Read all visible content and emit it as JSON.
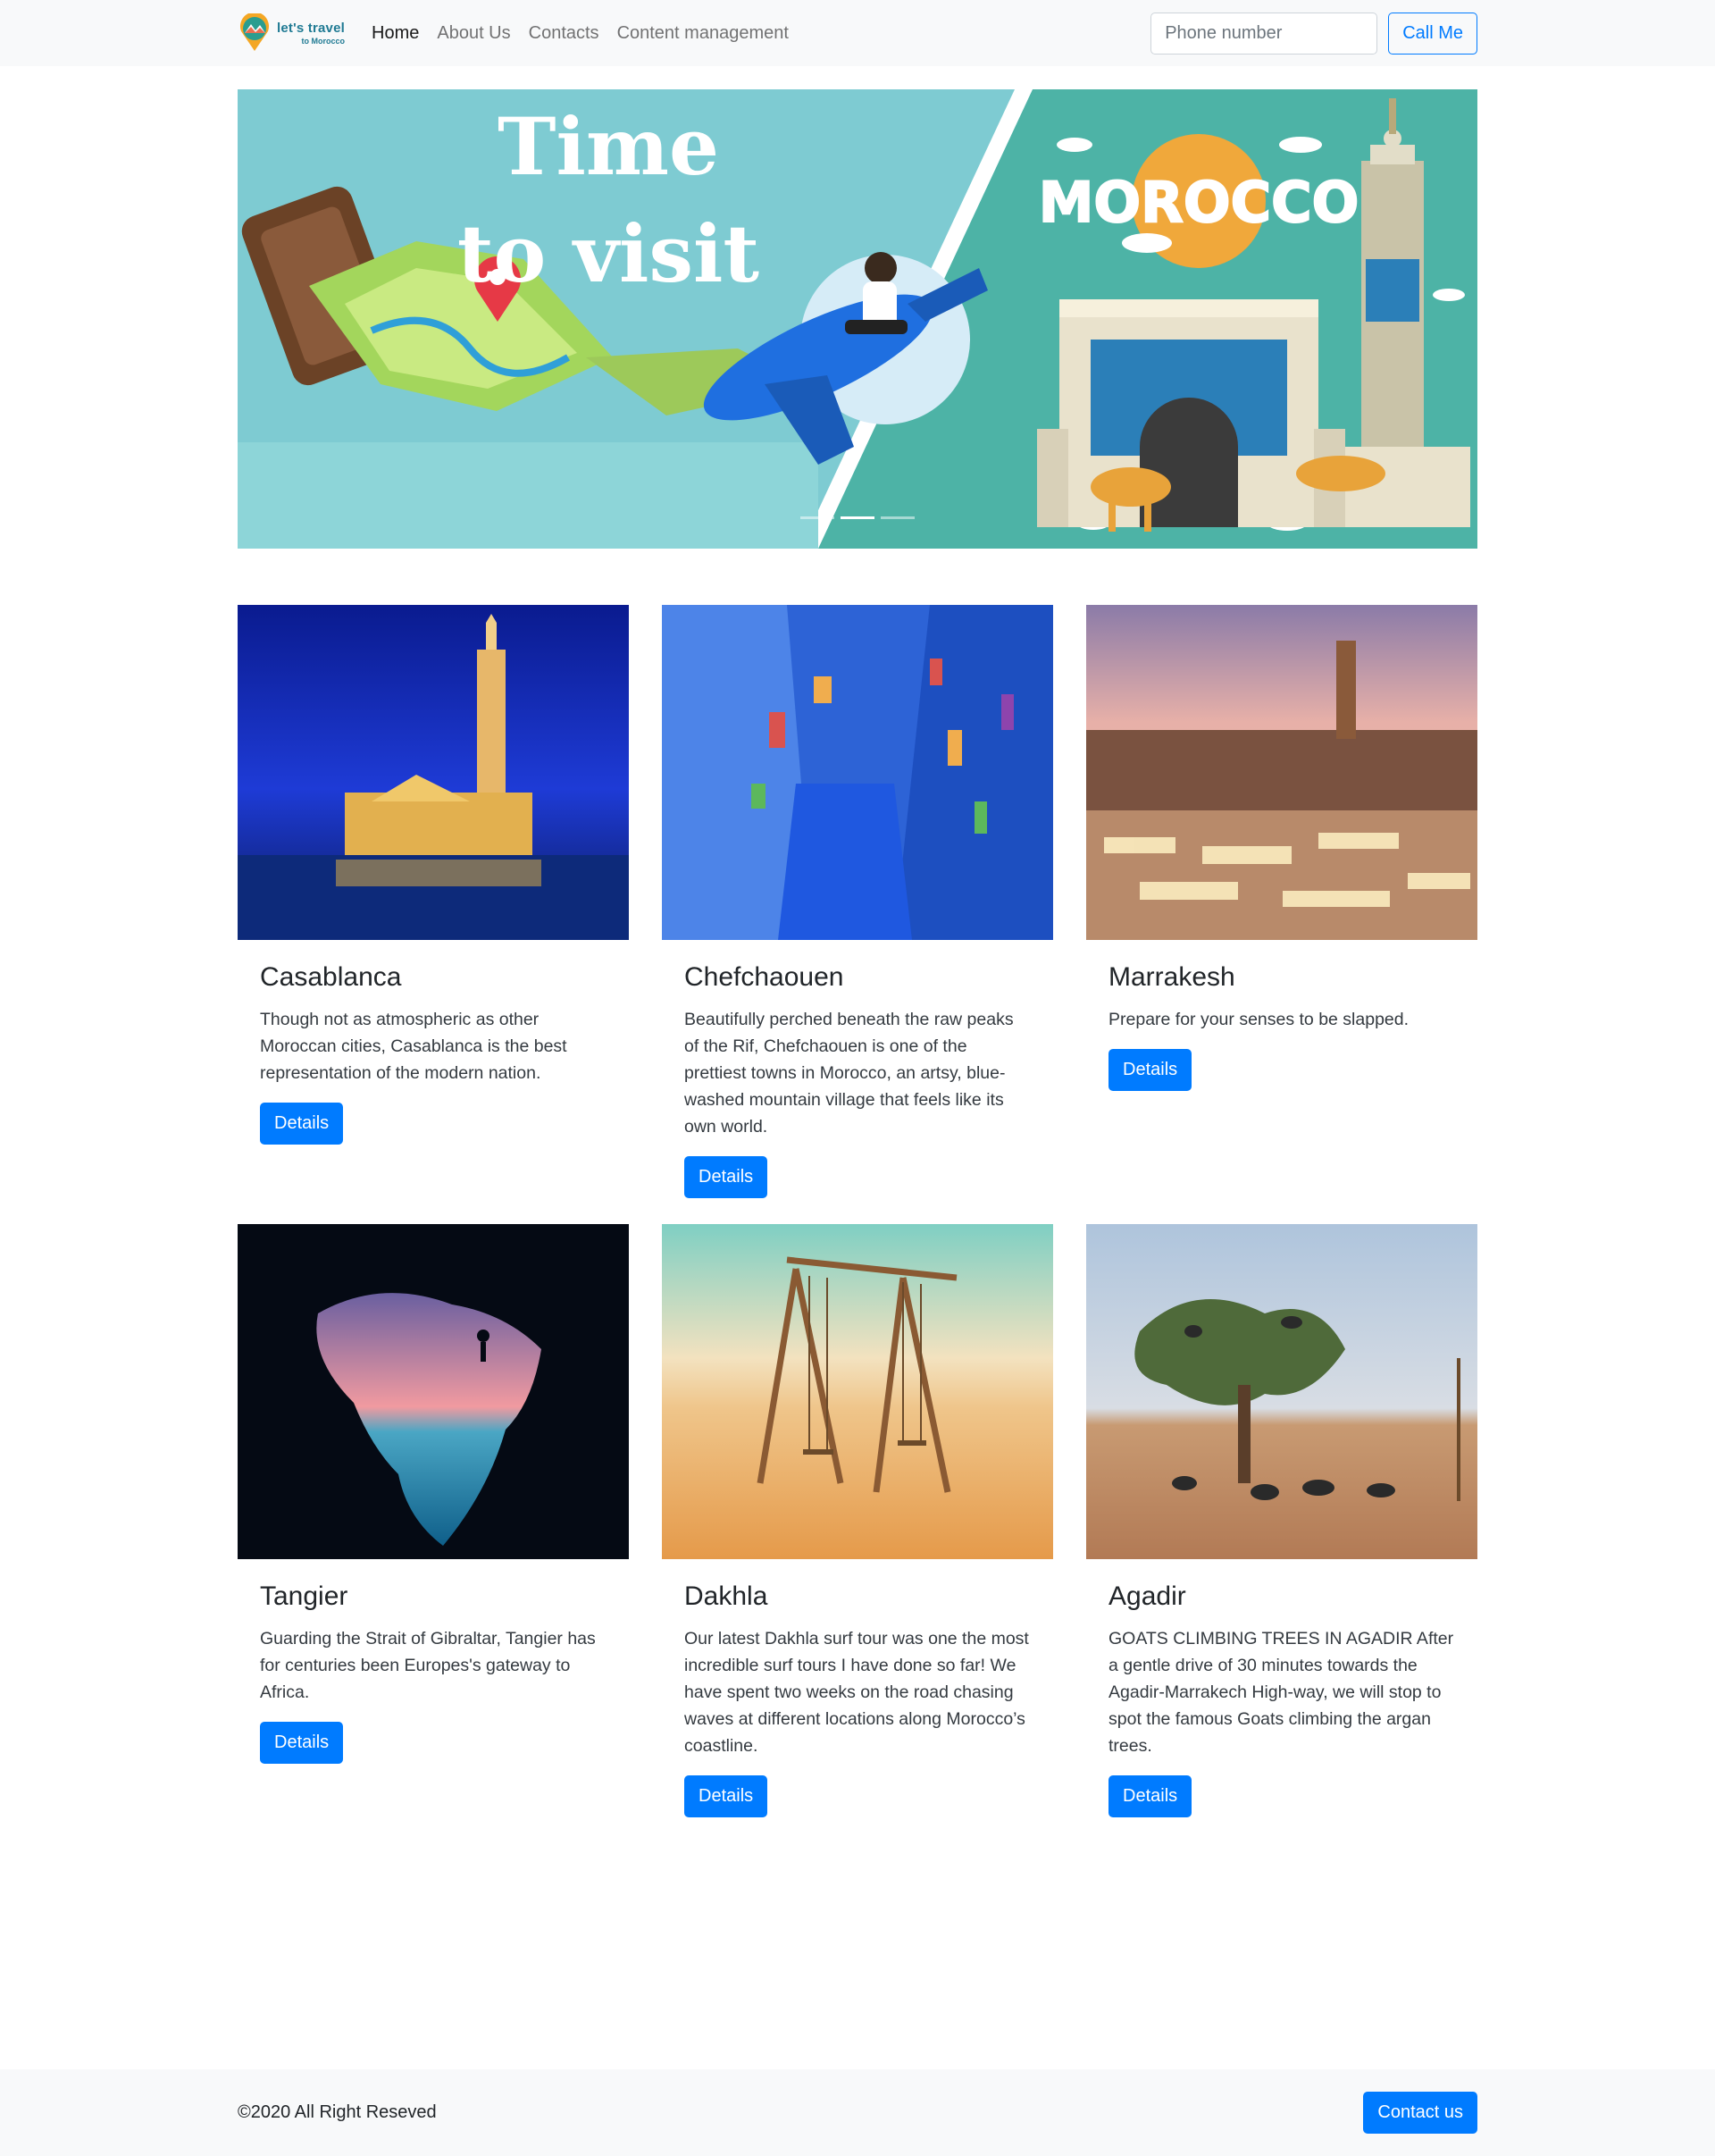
{
  "navbar": {
    "brand": {
      "line1": "let's travel",
      "line2": "to Morocco"
    },
    "links": [
      {
        "label": "Home",
        "active": true
      },
      {
        "label": "About Us",
        "active": false
      },
      {
        "label": "Contacts",
        "active": false
      },
      {
        "label": "Content management",
        "active": false
      }
    ],
    "phone_placeholder": "Phone number",
    "phone_value": "",
    "call_button": "Call Me"
  },
  "hero": {
    "headline_1": "Time",
    "headline_2": "to visit",
    "country": "MOROCCO",
    "slide_indicators": 3,
    "active_slide": 1
  },
  "cards": [
    {
      "title": "Casablanca",
      "text": "Though not as atmospheric as other Moroccan cities, Casablanca is the best representation of the modern nation.",
      "button": "Details"
    },
    {
      "title": "Chefchaouen",
      "text": "Beautifully perched beneath the raw peaks of the Rif, Chefchaouen is one of the prettiest towns in Morocco, an artsy, blue-washed mountain village that feels like its own world.",
      "button": "Details"
    },
    {
      "title": "Marrakesh",
      "text": "Prepare for your senses to be slapped.",
      "button": "Details"
    },
    {
      "title": "Tangier",
      "text": "Guarding the Strait of Gibraltar, Tangier has for centuries been Europes's gateway to Africa.",
      "button": "Details"
    },
    {
      "title": "Dakhla",
      "text": "Our latest Dakhla surf tour was one the most incredible surf tours I have done so far! We have spent two weeks on the road chasing waves at different locations along Morocco’s coastline.",
      "button": "Details"
    },
    {
      "title": "Agadir",
      "text": "GOATS CLIMBING TREES IN AGADIR After a gentle drive of 30 minutes towards the Agadir-Marrakech High-way, we will stop to spot the famous Goats climbing the argan trees.",
      "button": "Details"
    }
  ],
  "footer": {
    "copyright": "©2020 All Right Reseved",
    "contact_button": "Contact us"
  },
  "colors": {
    "primary": "#007bff",
    "navbar_bg": "#f8f9fa",
    "hero_left": "#7ecbd2",
    "hero_right": "#4db3a6",
    "sun": "#f0a83b"
  }
}
